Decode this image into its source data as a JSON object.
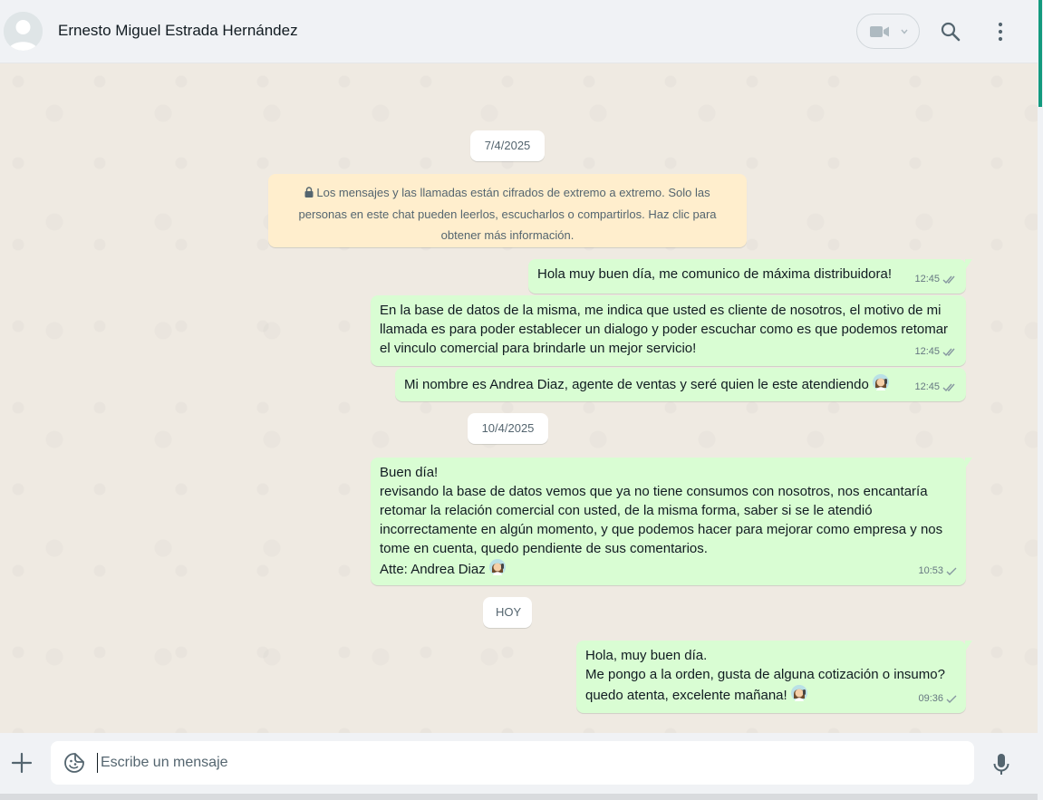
{
  "header": {
    "contact_name": "Ernesto Miguel Estrada Hernández",
    "icons": [
      "avatar-placeholder",
      "video-call-icon",
      "chevron-down-icon",
      "search-icon",
      "more-options-icon"
    ]
  },
  "chat": {
    "encryption_notice": "Los mensajes y las llamadas están cifrados de extremo a extremo. Solo las personas en este chat pueden leerlos, escucharlos o compartirlos. Haz clic para obtener más información.",
    "dates": [
      "7/4/2025",
      "10/4/2025",
      "HOY"
    ],
    "messages": [
      {
        "text": "Hola muy buen día, me comunico de máxima distribuidora!",
        "time": "12:45",
        "status": "read"
      },
      {
        "text": "En la base de datos de la misma, me indica que usted es cliente de nosotros, el motivo de mi llamada es para poder establecer un dialogo y poder escuchar como es que podemos retomar el vinculo comercial para brindarle un mejor servicio!",
        "time": "12:45",
        "status": "read"
      },
      {
        "text": "Mi nombre es Andrea Diaz, agente de ventas y seré quien le este atendiendo",
        "time": "12:45",
        "status": "read"
      },
      {
        "text": "Buen día!\nrevisando la base de datos vemos que ya no tiene consumos con nosotros, nos encantaría retomar la relación comercial con usted, de la misma forma, saber si se le atendió incorrectamente en algún momento, y que podemos hacer para mejorar como empresa y nos tome en cuenta, quedo pendiente de sus comentarios.\nAtte: Andrea Diaz",
        "time": "10:53",
        "status": "sent"
      },
      {
        "text": "Hola, muy buen día.\nMe pongo a la orden, gusta de alguna cotización o insumo?\nquedo atenta, excelente mañana!",
        "time": "09:36",
        "status": "sent"
      }
    ]
  },
  "composer": {
    "placeholder": "Escribe un mensaje",
    "icons": [
      "plus-icon",
      "sticker-emoji-icon",
      "microphone-icon"
    ]
  },
  "colors": {
    "header_bg": "#f0f2f5",
    "chat_bg": "#efeae2",
    "outgoing_bubble": "#d9fdd3",
    "encryption_notice_bg": "#ffeecd",
    "read_tick": "#53bdeb",
    "accent": "#00a884"
  }
}
